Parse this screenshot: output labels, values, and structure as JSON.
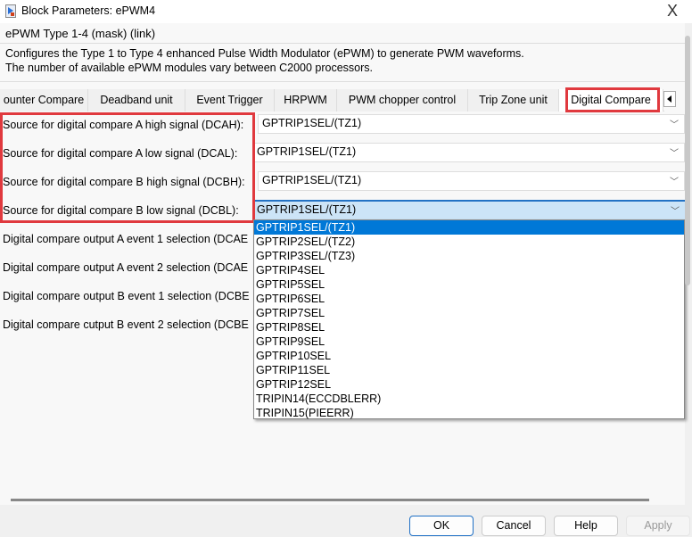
{
  "window": {
    "title": "Block Parameters: ePWM4",
    "close": "X"
  },
  "group": {
    "title": "ePWM Type 1-4 (mask) (link)",
    "description": [
      "Configures the Type 1 to Type 4 enhanced Pulse Width Modulator (ePWM) to generate PWM waveforms.",
      "The number of available ePWM modules vary between C2000 processors."
    ]
  },
  "tabs": [
    "ounter Compare",
    "Deadband unit",
    "Event Trigger",
    "HRPWM",
    "PWM chopper control",
    "Trip Zone unit",
    "Digital Compare"
  ],
  "active_tab": "Digital Compare",
  "params": [
    {
      "label": "Source for digital compare A high signal (DCAH):",
      "value": "GPTRIP1SEL/(TZ1)"
    },
    {
      "label": "Source for digital compare A low signal (DCAL):",
      "value": "GPTRIP1SEL/(TZ1)"
    },
    {
      "label": "Source for digital compare B high signal (DCBH):",
      "value": "GPTRIP1SEL/(TZ1)"
    },
    {
      "label": "Source for digital compare B low signal (DCBL):",
      "value": "GPTRIP1SEL/(TZ1)"
    },
    {
      "label": "Digital compare output A event 1 selection (DCAE"
    },
    {
      "label": "Digital compare output A event 2 selection (DCAE"
    },
    {
      "label": "Digital compare output B event 1 selection (DCBE"
    },
    {
      "label": "Digital compare cutput B event 2 selection (DCBE"
    }
  ],
  "dropdown_options": [
    "GPTRIP1SEL/(TZ1)",
    "GPTRIP2SEL/(TZ2)",
    "GPTRIP3SEL/(TZ3)",
    "GPTRIP4SEL",
    "GPTRIP5SEL",
    "GPTRIP6SEL",
    "GPTRIP7SEL",
    "GPTRIP8SEL",
    "GPTRIP9SEL",
    "GPTRIP10SEL",
    "GPTRIP11SEL",
    "GPTRIP12SEL",
    "TRIPIN14(ECCDBLERR)",
    "TRIPIN15(PIEERR)"
  ],
  "buttons": {
    "ok": "OK",
    "cancel": "Cancel",
    "help": "Help",
    "apply": "Apply"
  },
  "colors": {
    "highlight": "#e0393e",
    "selection": "#0078d7"
  }
}
